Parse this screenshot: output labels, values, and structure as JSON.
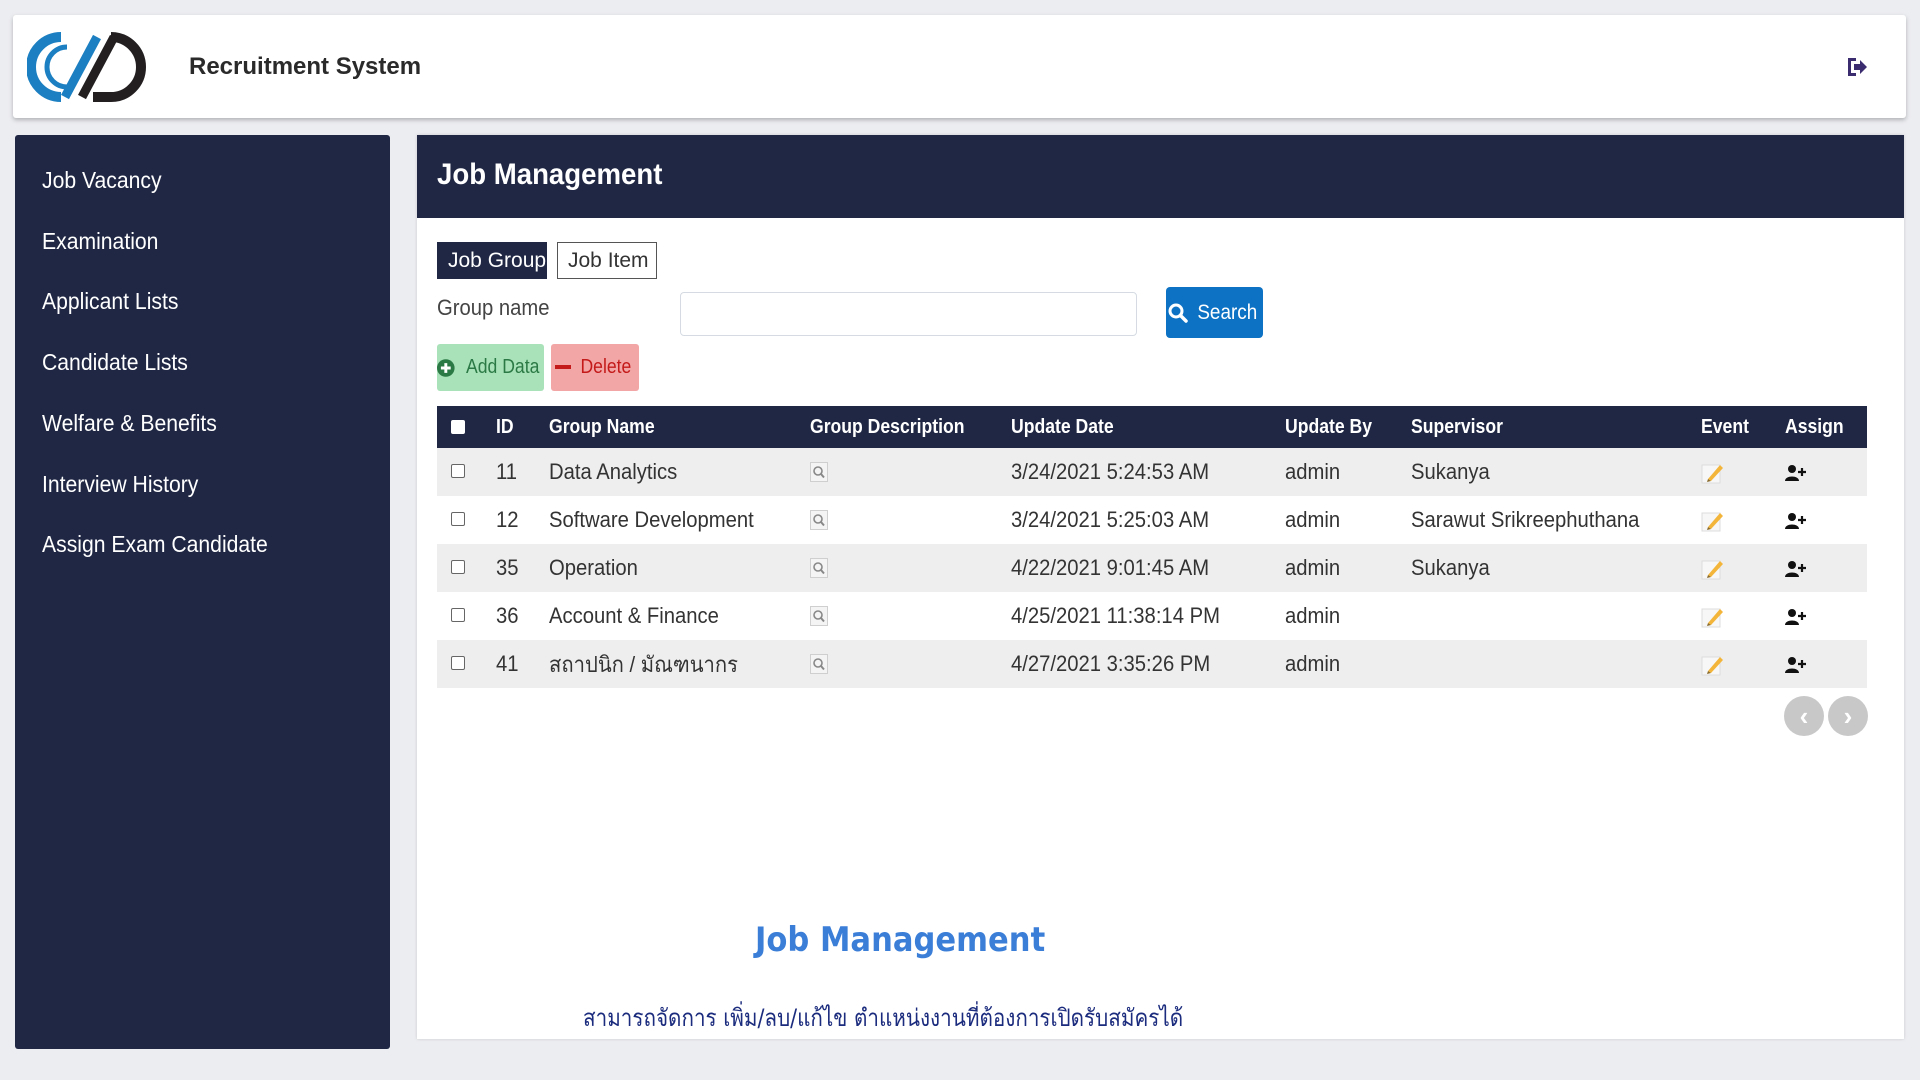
{
  "header": {
    "app_title": "Recruitment System",
    "logo_icon": "company-logo",
    "logout_icon": "sign-out-icon"
  },
  "sidebar": {
    "items": [
      {
        "label": "Job Vacancy"
      },
      {
        "label": "Examination"
      },
      {
        "label": "Applicant Lists"
      },
      {
        "label": "Candidate Lists"
      },
      {
        "label": "Welfare & Benefits"
      },
      {
        "label": "Interview History"
      },
      {
        "label": "Assign Exam Candidate"
      }
    ]
  },
  "main": {
    "title": "Job Management",
    "tabs": [
      {
        "label": "Job Group",
        "active": true
      },
      {
        "label": "Job Item",
        "active": false
      }
    ],
    "search": {
      "label": "Group name",
      "value": "",
      "button_label": "Search"
    },
    "actions": {
      "add_label": "Add Data",
      "delete_label": "Delete"
    },
    "table": {
      "columns": [
        "ID",
        "Group Name",
        "Group Description",
        "Update Date",
        "Update By",
        "Supervisor",
        "Event",
        "Assign"
      ],
      "rows": [
        {
          "id": "11",
          "group_name": "Data Analytics",
          "update_date": "3/24/2021 5:24:53 AM",
          "update_by": "admin",
          "supervisor": "Sukanya"
        },
        {
          "id": "12",
          "group_name": "Software Development",
          "update_date": "3/24/2021 5:25:03 AM",
          "update_by": "admin",
          "supervisor": "Sarawut Srikreephuthana"
        },
        {
          "id": "35",
          "group_name": "Operation",
          "update_date": "4/22/2021 9:01:45 AM",
          "update_by": "admin",
          "supervisor": "Sukanya"
        },
        {
          "id": "36",
          "group_name": "Account & Finance",
          "update_date": "4/25/2021 11:38:14 PM",
          "update_by": "admin",
          "supervisor": ""
        },
        {
          "id": "41",
          "group_name": "สถาปนิก / มัณฑนากร",
          "update_date": "4/27/2021 3:35:26 PM",
          "update_by": "admin",
          "supervisor": ""
        }
      ]
    },
    "pager": {
      "prev": "‹",
      "next": "›"
    }
  },
  "promo": {
    "title": "Job Management",
    "description": "สามารถจัดการ เพิ่ม/ลบ/แก้ไข ตำแหน่งงานที่ต้องการเปิดรับสมัครได้"
  },
  "colors": {
    "navy": "#1f2744",
    "primary_button": "#0d72c4",
    "add_button": "#a9e2b9",
    "delete_button": "#f2a6a6",
    "promo_title": "#3a7ed8",
    "promo_text": "#1b2b7d"
  }
}
